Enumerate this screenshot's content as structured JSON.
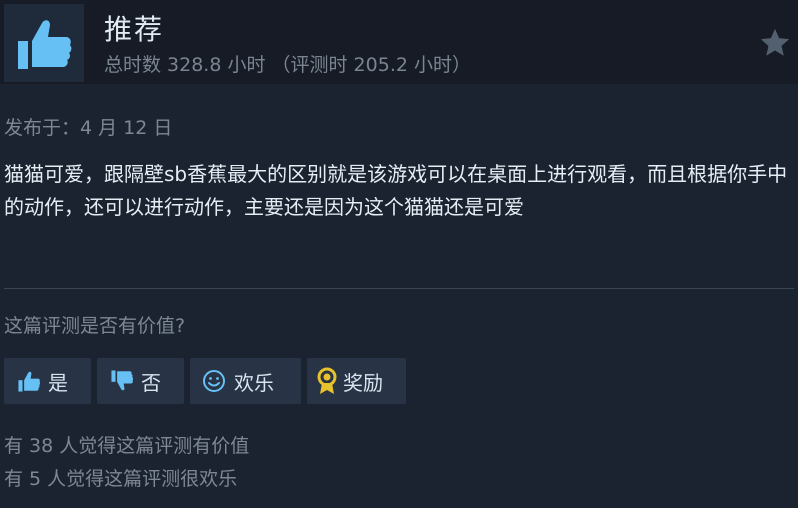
{
  "review": {
    "verdict": "推荐",
    "hours_text": "总时数 328.8 小时 （评测时 205.2 小时）",
    "posted": "发布于：4 月 12 日",
    "body": "猫猫可爱，跟隔壁sb香蕉最大的区别就是该游戏可以在桌面上进行观看，而且根据你手中的动作，还可以进行动作，主要还是因为这个猫猫还是可爱"
  },
  "feedback": {
    "question": "这篇评测是否有价值?",
    "yes_label": "是",
    "no_label": "否",
    "funny_label": "欢乐",
    "award_label": "奖励"
  },
  "stats": {
    "helpful": "有 38 人觉得这篇评测有价值",
    "funny": "有 5 人觉得这篇评测很欢乐"
  },
  "icons": {
    "header": "thumbs-up-icon",
    "star": "star-icon",
    "yes": "thumbs-up-icon",
    "no": "thumbs-down-icon",
    "funny": "smiley-icon",
    "award": "award-icon"
  },
  "colors": {
    "accent_blue": "#66c0f4",
    "award_gold": "#e8c22a",
    "background": "#1b2230"
  }
}
